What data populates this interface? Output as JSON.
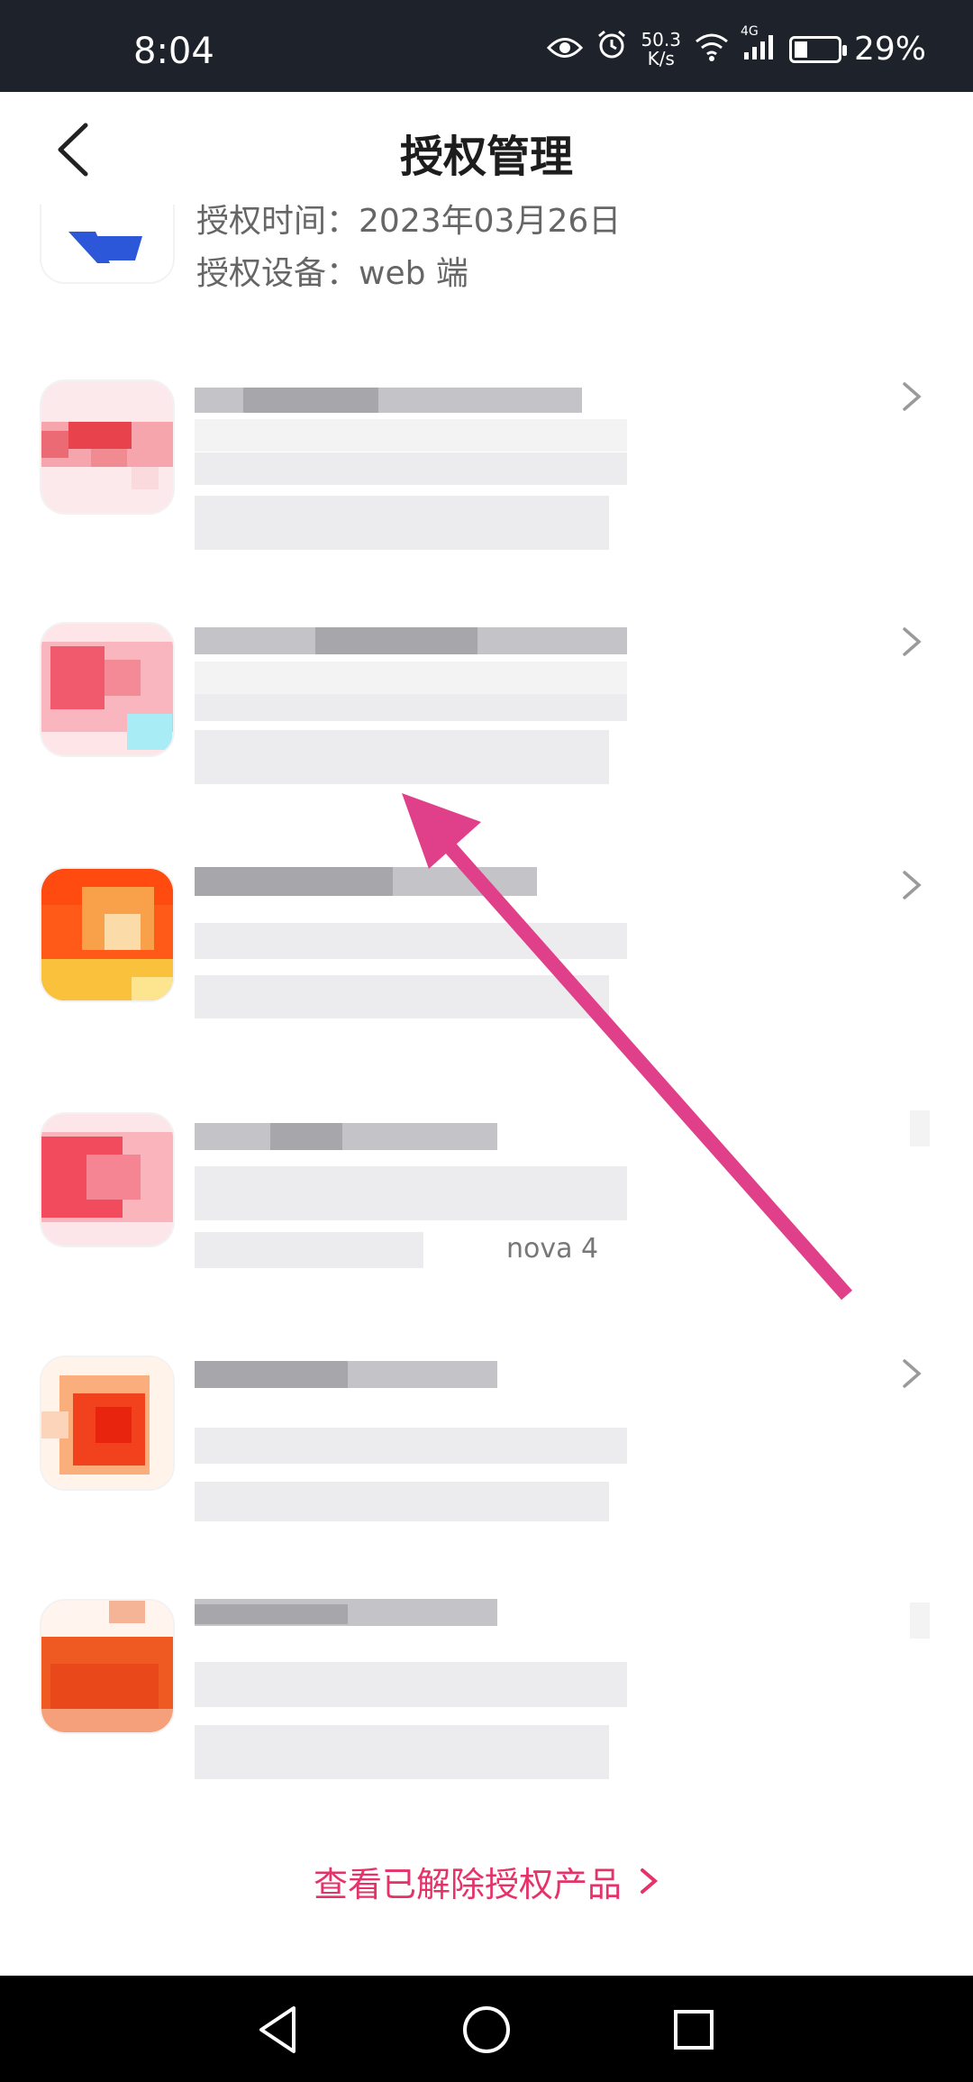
{
  "status_bar": {
    "time": "8:04",
    "net_speed_value": "50.3",
    "net_speed_unit": "K/s",
    "signal_label": "4G",
    "battery": "29%",
    "icons": [
      "eye-icon",
      "alarm-icon",
      "wifi-icon",
      "signal-icon",
      "battery-charging-icon"
    ]
  },
  "header": {
    "title": "授权管理",
    "back_icon": "chevron-left-icon"
  },
  "top_item": {
    "time_label": "授权时间：",
    "time_value": "2023年03月26日",
    "device_label": "授权设备：",
    "device_value": "web 端"
  },
  "items": [
    {
      "icon_colors": [
        "#e8434c",
        "#f6a5ad"
      ],
      "partial_text": ""
    },
    {
      "icon_colors": [
        "#f15a6c",
        "#f9b6bf"
      ],
      "partial_text": ""
    },
    {
      "icon_colors": [
        "#ff5a17",
        "#f9c13c"
      ],
      "partial_text": ""
    },
    {
      "icon_colors": [
        "#f24b5e",
        "#f9b4bc"
      ],
      "partial_text": "nova 4"
    },
    {
      "icon_colors": [
        "#f2421d",
        "#f9ae7c"
      ],
      "partial_text": ""
    },
    {
      "icon_colors": [
        "#ee5a22",
        "#f6a07b"
      ],
      "partial_text": ""
    }
  ],
  "footer": {
    "link_label": "查看已解除授权产品",
    "link_color": "#e5336a"
  },
  "colors": {
    "status_bar_bg": "#1e222b",
    "accent_arrow": "#e0408a",
    "nav_bar_bg": "#000000"
  }
}
